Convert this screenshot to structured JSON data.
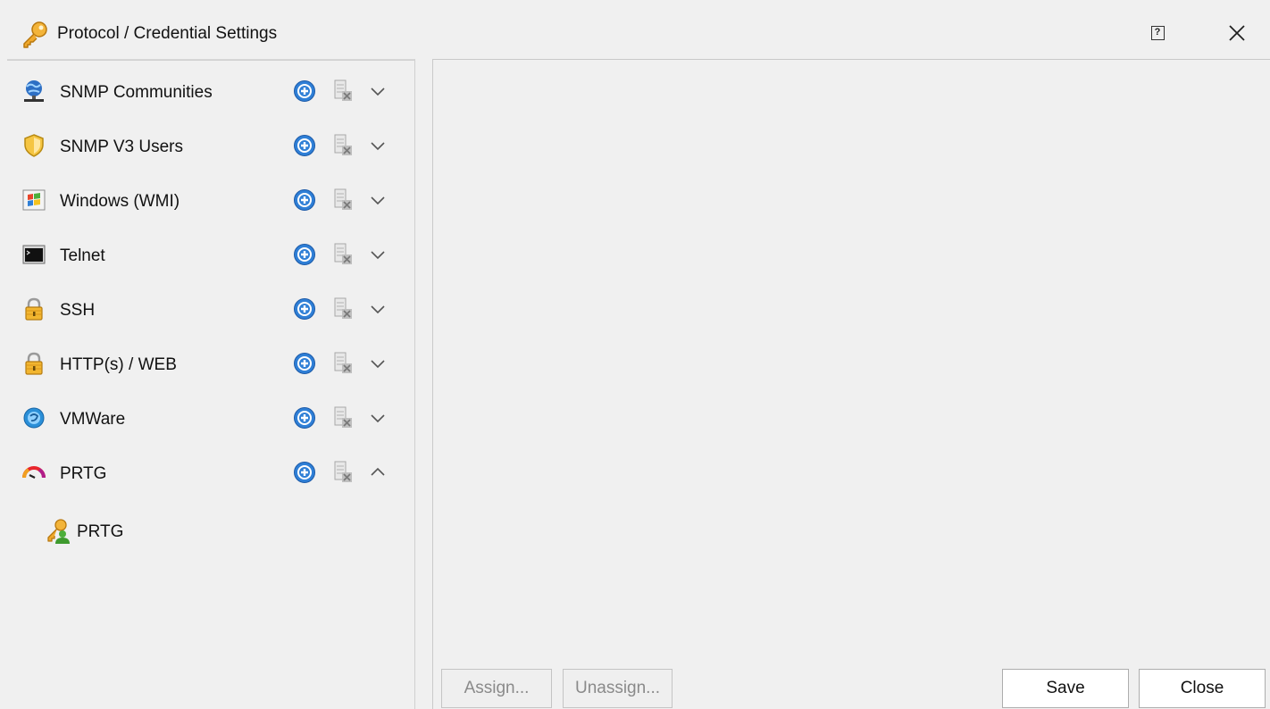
{
  "window": {
    "title": "Protocol / Credential Settings",
    "help_glyph": "?"
  },
  "protocols": [
    {
      "label": "SNMP Communities",
      "icon": "globe-network-icon",
      "expanded": false
    },
    {
      "label": "SNMP V3 Users",
      "icon": "shield-icon",
      "expanded": false
    },
    {
      "label": "Windows (WMI)",
      "icon": "windows-icon",
      "expanded": false
    },
    {
      "label": "Telnet",
      "icon": "terminal-icon",
      "expanded": false
    },
    {
      "label": "SSH",
      "icon": "lock-icon",
      "expanded": false
    },
    {
      "label": "HTTP(s) / WEB",
      "icon": "lock-icon",
      "expanded": false
    },
    {
      "label": "VMWare",
      "icon": "vmware-icon",
      "expanded": false
    },
    {
      "label": "PRTG",
      "icon": "prtg-gauge-icon",
      "expanded": true
    }
  ],
  "prtg_children": [
    {
      "label": "PRTG",
      "icon": "key-user-icon"
    }
  ],
  "buttons": {
    "assign": "Assign...",
    "unassign": "Unassign...",
    "save": "Save",
    "close": "Close"
  },
  "colors": {
    "window_bg": "#f0f0f0",
    "add_button_blue": "#2f7fd6"
  }
}
